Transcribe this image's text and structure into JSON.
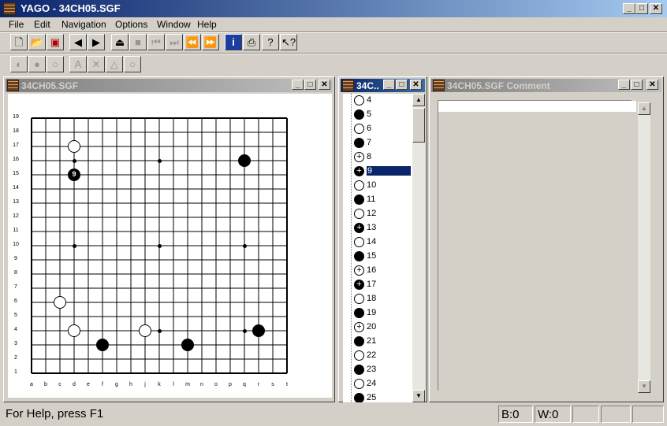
{
  "app": {
    "title": "YAGO - 34CH05.SGF"
  },
  "menu": [
    "File",
    "Edit",
    "Navigation",
    "Options",
    "Window",
    "Help"
  ],
  "toolbar1": [
    {
      "name": "new-file-icon",
      "glyph": "🗋",
      "enabled": true
    },
    {
      "name": "open-folder-icon",
      "glyph": "📂",
      "enabled": true
    },
    {
      "name": "save-icon",
      "glyph": "▣",
      "enabled": true
    },
    {
      "name": "back-icon",
      "glyph": "◀",
      "enabled": true
    },
    {
      "name": "forward-icon",
      "glyph": "▶",
      "enabled": true
    },
    {
      "name": "eject-icon",
      "glyph": "⏏",
      "enabled": true
    },
    {
      "name": "stop-icon",
      "glyph": "■",
      "enabled": false
    },
    {
      "name": "first-move-icon",
      "glyph": "⏮",
      "enabled": false
    },
    {
      "name": "last-move-icon",
      "glyph": "⏭",
      "enabled": false
    },
    {
      "name": "rewind-icon",
      "glyph": "⏪",
      "enabled": false
    },
    {
      "name": "fast-forward-icon",
      "glyph": "⏩",
      "enabled": false
    },
    {
      "name": "info-icon",
      "glyph": "i",
      "enabled": true
    },
    {
      "name": "print-icon",
      "glyph": "⎙",
      "enabled": true
    },
    {
      "name": "help-icon",
      "glyph": "?",
      "enabled": true
    },
    {
      "name": "context-help-icon",
      "glyph": "↖?",
      "enabled": true
    }
  ],
  "toolbar2": [
    {
      "name": "alternate-stone-icon",
      "glyph": "◐"
    },
    {
      "name": "black-stone-icon",
      "glyph": "●"
    },
    {
      "name": "white-stone-icon",
      "glyph": "○"
    },
    {
      "name": "label-a-icon",
      "glyph": "A"
    },
    {
      "name": "mark-x-icon",
      "glyph": "✕"
    },
    {
      "name": "triangle-mark-icon",
      "glyph": "△"
    },
    {
      "name": "circle-mark-icon",
      "glyph": "○"
    }
  ],
  "board_window": {
    "title": "34CH05.SGF"
  },
  "board": {
    "columns": [
      "a",
      "b",
      "c",
      "d",
      "e",
      "f",
      "g",
      "h",
      "j",
      "k",
      "l",
      "m",
      "n",
      "o",
      "p",
      "q",
      "r",
      "s",
      "t"
    ],
    "rows": [
      "19",
      "18",
      "17",
      "16",
      "15",
      "14",
      "13",
      "12",
      "11",
      "10",
      "9",
      "8",
      "7",
      "6",
      "5",
      "4",
      "3",
      "2",
      "1"
    ],
    "stones": [
      {
        "col": "d",
        "row": 17,
        "color": "white",
        "label": ""
      },
      {
        "col": "d",
        "row": 15,
        "color": "black",
        "label": "9"
      },
      {
        "col": "q",
        "row": 16,
        "color": "black",
        "label": ""
      },
      {
        "col": "c",
        "row": 6,
        "color": "white",
        "label": ""
      },
      {
        "col": "d",
        "row": 4,
        "color": "white",
        "label": ""
      },
      {
        "col": "j",
        "row": 4,
        "color": "white",
        "label": ""
      },
      {
        "col": "f",
        "row": 3,
        "color": "black",
        "label": ""
      },
      {
        "col": "m",
        "row": 3,
        "color": "black",
        "label": ""
      },
      {
        "col": "r",
        "row": 4,
        "color": "black",
        "label": ""
      }
    ]
  },
  "tree_window": {
    "title": "34C..."
  },
  "moves": [
    {
      "n": "4",
      "color": "white"
    },
    {
      "n": "5",
      "color": "black"
    },
    {
      "n": "6",
      "color": "white"
    },
    {
      "n": "7",
      "color": "black"
    },
    {
      "n": "8",
      "color": "white-plus"
    },
    {
      "n": "9",
      "color": "black-plus",
      "selected": true
    },
    {
      "n": "10",
      "color": "white"
    },
    {
      "n": "11",
      "color": "black"
    },
    {
      "n": "12",
      "color": "white"
    },
    {
      "n": "13",
      "color": "black-plus"
    },
    {
      "n": "14",
      "color": "white"
    },
    {
      "n": "15",
      "color": "black"
    },
    {
      "n": "16",
      "color": "white-plus"
    },
    {
      "n": "17",
      "color": "black-plus"
    },
    {
      "n": "18",
      "color": "white"
    },
    {
      "n": "19",
      "color": "black"
    },
    {
      "n": "20",
      "color": "white-plus"
    },
    {
      "n": "21",
      "color": "black"
    },
    {
      "n": "22",
      "color": "white"
    },
    {
      "n": "23",
      "color": "black"
    },
    {
      "n": "24",
      "color": "white"
    },
    {
      "n": "25",
      "color": "black"
    }
  ],
  "comment_window": {
    "title": "34CH05.SGF Comment",
    "text": ""
  },
  "status": {
    "help": "For Help, press F1",
    "black": "B:0",
    "white": "W:0"
  }
}
